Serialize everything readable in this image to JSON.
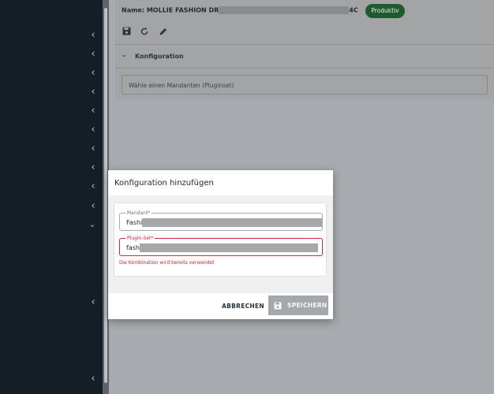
{
  "sidebar": {
    "chevron_icon": "chevron-left-icon",
    "expand_icon": "chevron-down-icon"
  },
  "header": {
    "name_label": "Name: MOLLIE FASHION DR",
    "name_suffix": "4C",
    "status_badge": "Produktiv"
  },
  "toolbar": {
    "icons": [
      "save-icon",
      "refresh-icon",
      "edit-icon"
    ]
  },
  "section": {
    "title": "Konfiguration",
    "select_placeholder": "Wähle einen Mandanten (Pluginset)"
  },
  "dialog": {
    "title": "Konfiguration hinzufügen",
    "fields": {
      "mandant": {
        "label": "Mandant*",
        "value": "Fashi"
      },
      "plugin_set": {
        "label": "Plugin-Set*",
        "value": "fash"
      }
    },
    "error_message": "Die Kombination wird bereits verwendet",
    "cancel_label": "ABBRECHEN",
    "save_label": "SPEICHERN"
  },
  "colors": {
    "sidebar_bg": "#131e26",
    "status_green": "#1f5a2f",
    "error_red": "#d9223b",
    "save_disabled": "#a4a8ad"
  }
}
